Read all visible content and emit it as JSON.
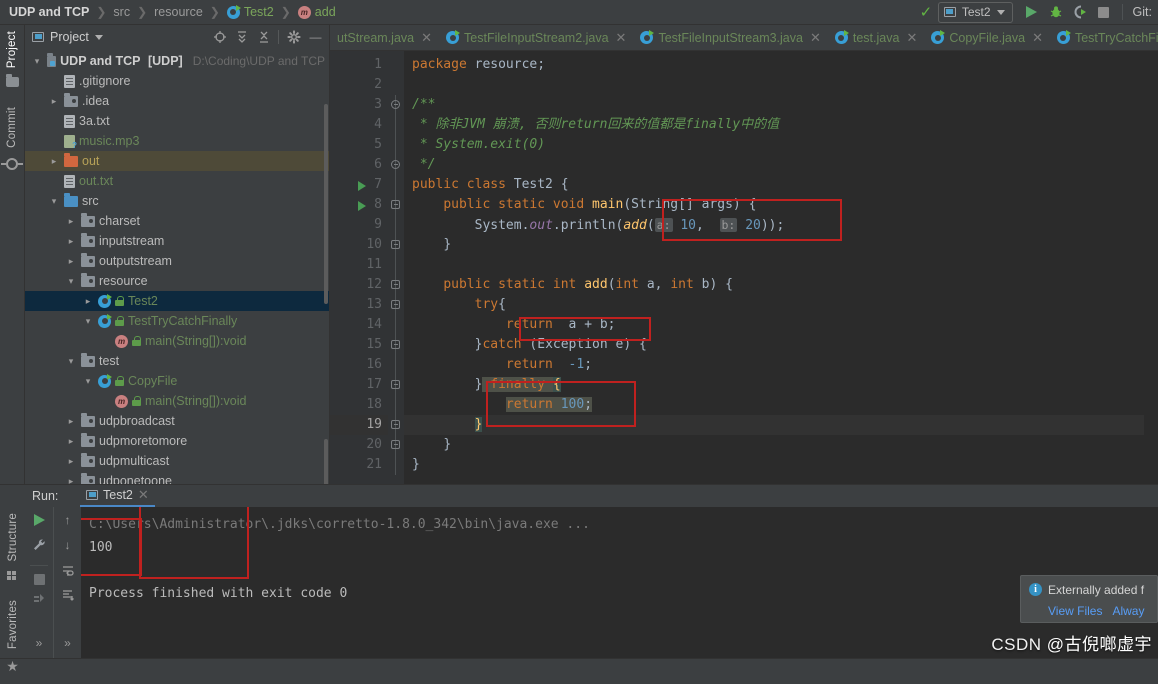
{
  "breadcrumb": {
    "project": "UDP and TCP",
    "src": "src",
    "pkg": "resource",
    "cls": "Test2",
    "method": "add"
  },
  "toolbar": {
    "run_config": "Test2",
    "git_label": "Git:",
    "icons": [
      "check-icon",
      "run-icon",
      "debug-icon",
      "run-coverage-icon",
      "stop-icon"
    ]
  },
  "left_strip": {
    "project_label": "Project",
    "commit_label": "Commit",
    "structure_label": "Structure",
    "favorites_label": "Favorites"
  },
  "project_panel": {
    "title": "Project",
    "tree": [
      {
        "indent": 0,
        "arrow": "v",
        "icon": "module-folder-icon",
        "label": "UDP and TCP",
        "bold": true,
        "suffix": "[UDP]",
        "path": "D:\\Coding\\UDP and TCP",
        "state": "normal"
      },
      {
        "indent": 1,
        "arrow": "none",
        "icon": "gitignore-file-icon",
        "label": ".gitignore",
        "state": "normal"
      },
      {
        "indent": 1,
        "arrow": ">",
        "icon": "folder-icon",
        "label": ".idea",
        "state": "normal"
      },
      {
        "indent": 1,
        "arrow": "none",
        "icon": "text-file-icon",
        "label": "3a.txt",
        "state": "normal"
      },
      {
        "indent": 1,
        "arrow": "none",
        "icon": "mp3-file-icon",
        "label": "music.mp3",
        "state": "green"
      },
      {
        "indent": 1,
        "arrow": ">",
        "icon": "out-folder-icon",
        "label": "out",
        "state": "hl-yellow"
      },
      {
        "indent": 1,
        "arrow": "none",
        "icon": "text-file-icon",
        "label": "out.txt",
        "state": "green"
      },
      {
        "indent": 1,
        "arrow": "v",
        "icon": "src-folder-icon",
        "label": "src",
        "state": "normal"
      },
      {
        "indent": 2,
        "arrow": ">",
        "icon": "package-icon",
        "label": "charset",
        "state": "normal"
      },
      {
        "indent": 2,
        "arrow": ">",
        "icon": "package-icon",
        "label": "inputstream",
        "state": "normal"
      },
      {
        "indent": 2,
        "arrow": ">",
        "icon": "package-icon",
        "label": "outputstream",
        "state": "normal"
      },
      {
        "indent": 2,
        "arrow": "v",
        "icon": "package-icon",
        "label": "resource",
        "state": "normal"
      },
      {
        "indent": 3,
        "arrow": ">",
        "icon": "java-class-icon",
        "label": "Test2",
        "state": "selected",
        "lock": true
      },
      {
        "indent": 3,
        "arrow": "v",
        "icon": "java-class-icon",
        "label": "TestTryCatchFinally",
        "state": "green",
        "lock": true
      },
      {
        "indent": 4,
        "arrow": "none",
        "icon": "method-icon",
        "label": "main(String[]):void",
        "state": "green",
        "lock": true
      },
      {
        "indent": 2,
        "arrow": "v",
        "icon": "package-icon",
        "label": "test",
        "state": "normal"
      },
      {
        "indent": 3,
        "arrow": "v",
        "icon": "java-class-icon",
        "label": "CopyFile",
        "state": "green",
        "lock": true
      },
      {
        "indent": 4,
        "arrow": "none",
        "icon": "method-icon",
        "label": "main(String[]):void",
        "state": "green",
        "lock": true
      },
      {
        "indent": 2,
        "arrow": ">",
        "icon": "package-icon",
        "label": "udpbroadcast",
        "state": "normal"
      },
      {
        "indent": 2,
        "arrow": ">",
        "icon": "package-icon",
        "label": "udpmoretomore",
        "state": "normal"
      },
      {
        "indent": 2,
        "arrow": ">",
        "icon": "package-icon",
        "label": "udpmulticast",
        "state": "normal"
      },
      {
        "indent": 2,
        "arrow": ">",
        "icon": "package-icon",
        "label": "udponetoone",
        "state": "normal"
      }
    ]
  },
  "editor": {
    "tabs": [
      {
        "label": "utStream.java",
        "active": false,
        "clipped": true
      },
      {
        "label": "TestFileInputStream2.java",
        "active": false
      },
      {
        "label": "TestFileInputStream3.java",
        "active": false
      },
      {
        "label": "test.java",
        "active": false
      },
      {
        "label": "CopyFile.java",
        "active": false
      },
      {
        "label": "TestTryCatchFi",
        "active": false,
        "clipped": true
      }
    ],
    "lines": [
      {
        "n": 1,
        "runmark": false
      },
      {
        "n": 2,
        "runmark": false
      },
      {
        "n": 3,
        "runmark": false
      },
      {
        "n": 4,
        "runmark": false
      },
      {
        "n": 5,
        "runmark": false
      },
      {
        "n": 6,
        "runmark": false
      },
      {
        "n": 7,
        "runmark": true
      },
      {
        "n": 8,
        "runmark": true
      },
      {
        "n": 9,
        "runmark": false
      },
      {
        "n": 10,
        "runmark": false
      },
      {
        "n": 11,
        "runmark": false
      },
      {
        "n": 12,
        "runmark": false
      },
      {
        "n": 13,
        "runmark": false
      },
      {
        "n": 14,
        "runmark": false
      },
      {
        "n": 15,
        "runmark": false
      },
      {
        "n": 16,
        "runmark": false
      },
      {
        "n": 17,
        "runmark": false
      },
      {
        "n": 18,
        "runmark": false
      },
      {
        "n": 19,
        "runmark": false,
        "current": true
      },
      {
        "n": 20,
        "runmark": false
      },
      {
        "n": 21,
        "runmark": false
      }
    ],
    "source": {
      "l1": "package resource;",
      "l3": "/**",
      "l4": " * 除非JVM 崩溃, 否则return回来的值都是finally中的值",
      "l5": " * System.exit(0)",
      "l6": " */",
      "l7": "public class Test2 {",
      "l8": "    public static void main(String[] args) {",
      "l9": "        System.out.println(add( a: 10,  b: 20));",
      "l10": "    }",
      "l12": "    public static int add(int a, int b) {",
      "l13": "        try{",
      "l14": "            return  a + b;",
      "l15": "        }catch (Exception e) {",
      "l16": "            return  -1;",
      "l17": "        } finally {",
      "l18": "            return 100;",
      "l19": "        }",
      "l20": "    }",
      "l21": "}",
      "hint_a": "a:",
      "hint_b": "b:"
    }
  },
  "run_panel": {
    "label": "Run:",
    "tab": "Test2",
    "tools": [
      "rerun-icon",
      "settings-wrench-icon",
      "stop-icon",
      "dump-threads-icon",
      "expand-more-icon"
    ],
    "tools2": [
      "up-arrow-icon",
      "down-arrow-icon",
      "soft-wrap-icon",
      "scroll-to-end-icon",
      "expand-more-icon"
    ],
    "console": [
      {
        "text": "C:\\Users\\Administrator\\.jdks\\corretto-1.8.0_342\\bin\\java.exe ...",
        "dim": true
      },
      {
        "text": "100",
        "dim": false
      },
      {
        "text": "",
        "dim": false
      },
      {
        "text": "Process finished with exit code 0",
        "dim": false
      }
    ]
  },
  "notification": {
    "title": "Externally added f",
    "link1": "View Files",
    "link2": "Alway"
  },
  "watermark": {
    "brand": "CSDN",
    "author": "@古倪啷虚宇"
  },
  "annotations": {
    "box_args": "red-rect-around-parameter-hints",
    "box_return_ab": "red-rect-around-return-a-plus-b",
    "box_finally": "red-rect-around-finally-block",
    "box_console_left": "red-rect-console-left",
    "box_console_100": "red-rect-around-100-output"
  }
}
